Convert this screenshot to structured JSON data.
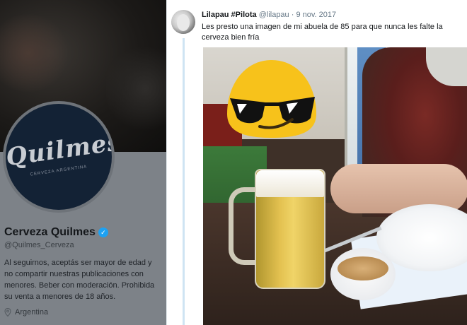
{
  "profile": {
    "logo_text": "Quilmes",
    "logo_subtext": "CERVEZA ARGENTINA",
    "name": "Cerveza Quilmes",
    "verified_icon": "verified-badge-icon",
    "handle": "@Quilmes_Cerveza",
    "bio": "Al seguirnos, aceptás ser mayor de edad y no compartir nuestras publicaciones con menores. Beber con moderación. Prohibida su venta a menores de 18 años.",
    "location_icon": "map-pin-icon",
    "location": "Argentina"
  },
  "tweet": {
    "author": "Lilapau #Pilota",
    "handle": "@lilapau",
    "separator": "·",
    "date": "9 nov. 2017",
    "text": "Les presto una imagen de mi abuela de 85 para que nunca les falte la cerveza bien fría",
    "photo_overlay_icon": "sunglasses-emoji-icon"
  },
  "colors": {
    "verified": "#1da1f2",
    "thread_line": "#cfe4f3",
    "emoji_yellow": "#f7c21b"
  }
}
